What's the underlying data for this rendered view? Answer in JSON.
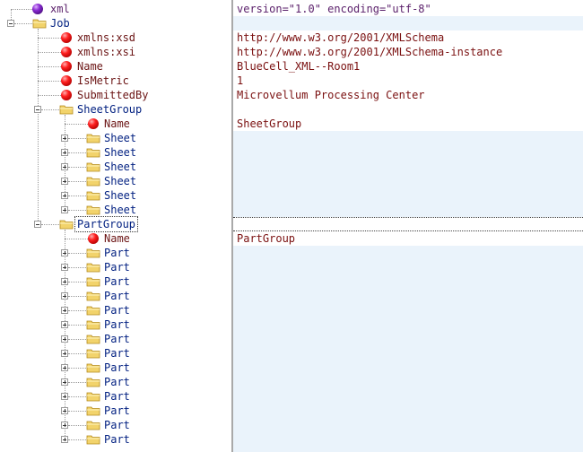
{
  "tree": {
    "xml_decl": {
      "label": "xml",
      "value": "version=\"1.0\" encoding=\"utf-8\""
    },
    "job": {
      "label": "Job",
      "attributes": [
        {
          "label": "xmlns:xsd",
          "value": "http://www.w3.org/2001/XMLSchema"
        },
        {
          "label": "xmlns:xsi",
          "value": "http://www.w3.org/2001/XMLSchema-instance"
        },
        {
          "label": "Name",
          "value": "BlueCell_XML--Room1"
        },
        {
          "label": "IsMetric",
          "value": "1"
        },
        {
          "label": "SubmittedBy",
          "value": "Microvellum Processing Center"
        }
      ],
      "sheet_group": {
        "label": "SheetGroup",
        "name_attr": {
          "label": "Name",
          "value": "SheetGroup"
        },
        "children": [
          "Sheet",
          "Sheet",
          "Sheet",
          "Sheet",
          "Sheet",
          "Sheet"
        ]
      },
      "part_group": {
        "label": "PartGroup",
        "name_attr": {
          "label": "Name",
          "value": "PartGroup"
        },
        "children": [
          "Part",
          "Part",
          "Part",
          "Part",
          "Part",
          "Part",
          "Part",
          "Part",
          "Part",
          "Part",
          "Part",
          "Part",
          "Part",
          "Part"
        ]
      }
    }
  },
  "icons": {
    "attribute": "red-ball-icon",
    "declaration": "purple-ball-icon",
    "element": "folder-icon"
  },
  "colors": {
    "value_fill": "#eaf3fb",
    "attr_ball": "#ff2020",
    "decl_ball": "#8a2bd2",
    "folder": "#f2d36b"
  }
}
